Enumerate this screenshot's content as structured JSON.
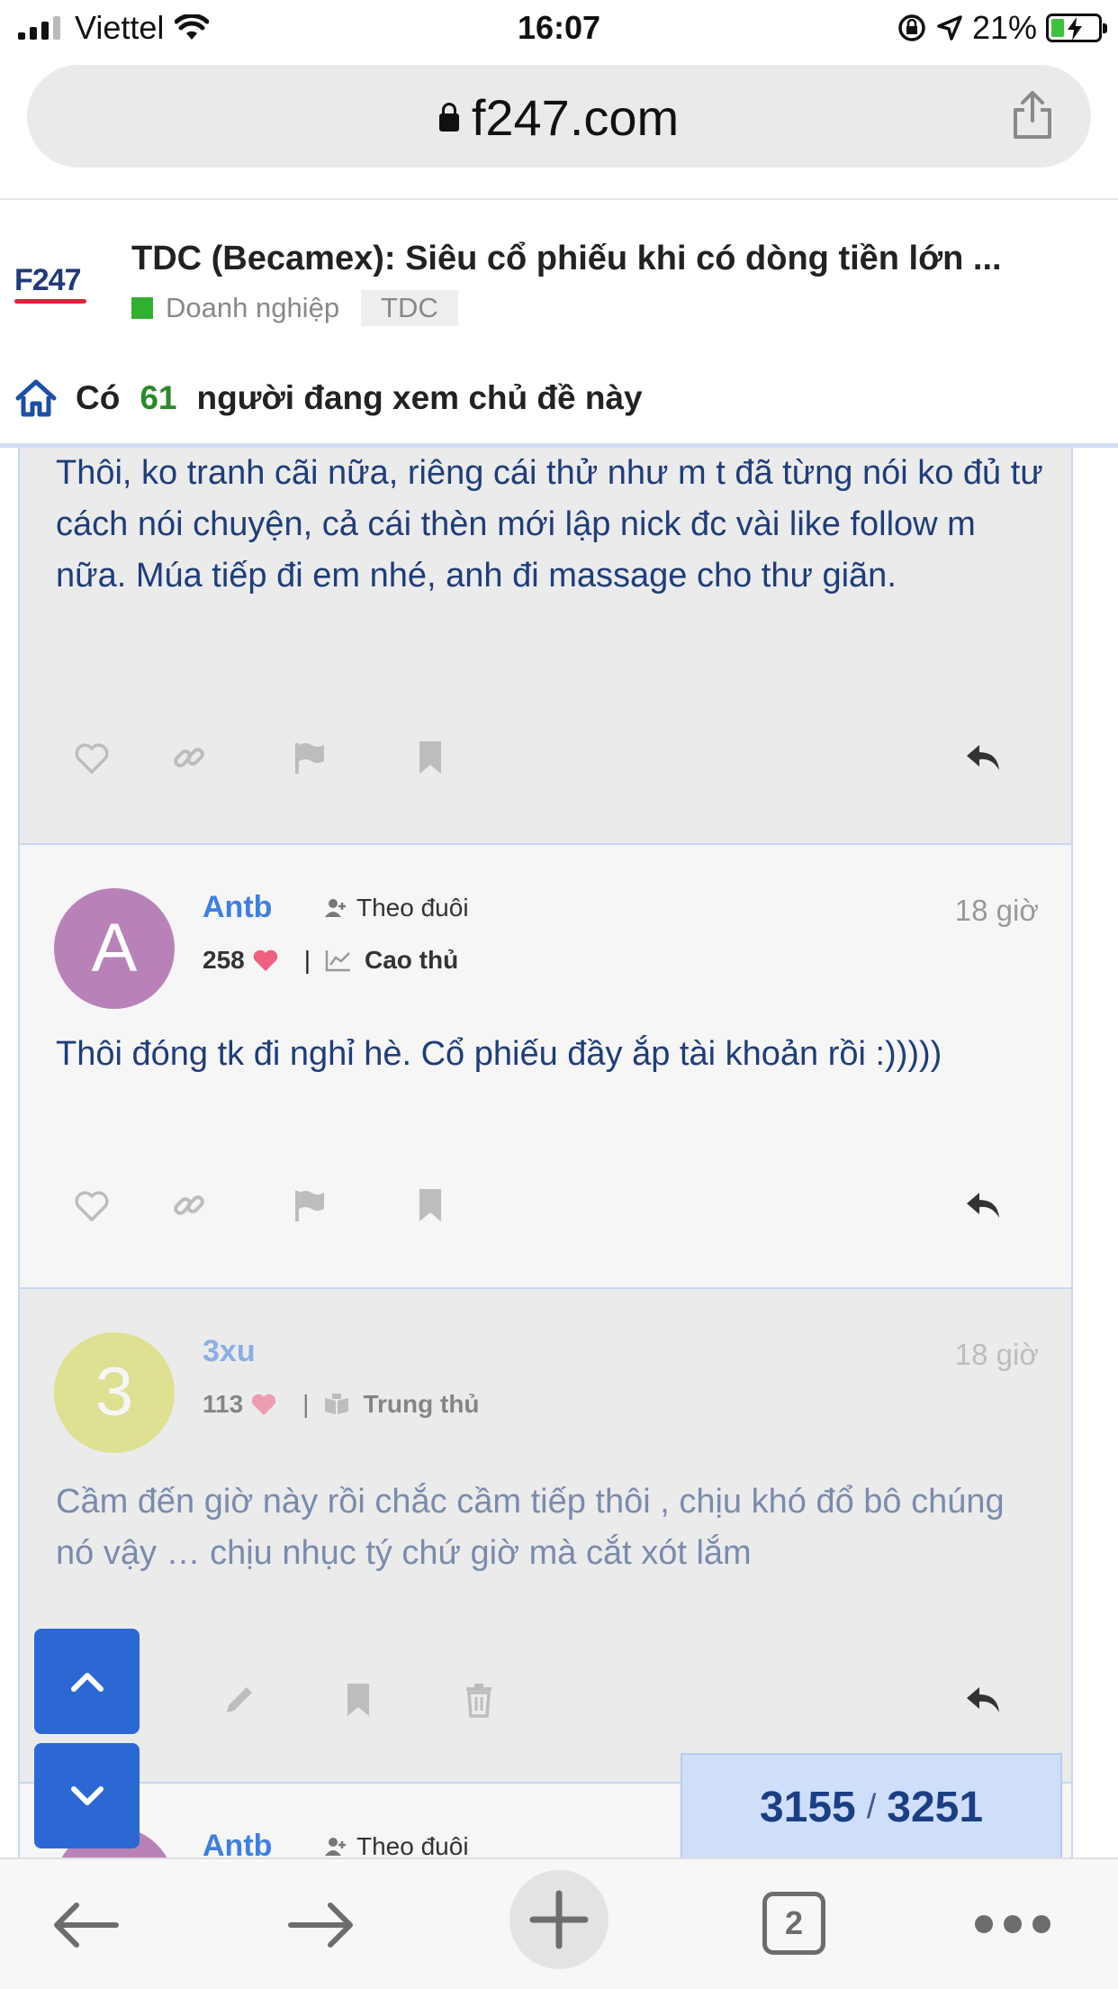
{
  "status_bar": {
    "carrier": "Viettel",
    "time": "16:07",
    "battery": "21%",
    "icons": [
      "signal-icon",
      "wifi-icon",
      "lock-rotation-icon",
      "location-icon",
      "battery-charging-icon"
    ]
  },
  "browser": {
    "url": "f247.com"
  },
  "topic": {
    "logo_text": "F247",
    "title": "TDC (Becamex): Siêu cổ phiếu khi có dòng tiền lớn ...",
    "category": "Doanh nghiệp",
    "category_color": "#2fb12f",
    "tag": "TDC"
  },
  "viewers": {
    "prefix": "Có",
    "count": "61",
    "suffix": "người đang xem chủ đề này"
  },
  "posts": [
    {
      "body": "Thôi, ko tranh cãi nữa, riêng cái thử như m t đã từng nói ko đủ tư cách nói chuyện, cả cái thèn mới lập nick đc vài like follow m nữa. Múa tiếp đi em nhé, anh đi massage cho thư giãn."
    },
    {
      "avatar_letter": "A",
      "avatar_color": "#b882b8",
      "username": "Antb",
      "follow_label": "Theo đuôi",
      "likes": "258",
      "rank": "Cao thủ",
      "time": "18 giờ",
      "body": "Thôi đóng tk đi nghỉ hè. Cổ phiếu đầy ắp tài khoản rồi :)))))"
    },
    {
      "avatar_letter": "3",
      "avatar_color": "#d4d84a",
      "username": "3xu",
      "likes": "113",
      "rank": "Trung thủ",
      "time": "18 giờ",
      "body": "Cầm đến giờ này rồi chắc cầm tiếp thôi , chịu khó đổ bô chúng nó vậy … chịu nhục tý chứ giờ mà cắt xót lắm"
    },
    {
      "avatar_color": "#b882b8",
      "username": "Antb",
      "follow_label": "Theo đuôi"
    }
  ],
  "progress": {
    "current": "3155",
    "separator": "/",
    "total": "3251"
  },
  "toolbar": {
    "tab_count": "2"
  }
}
